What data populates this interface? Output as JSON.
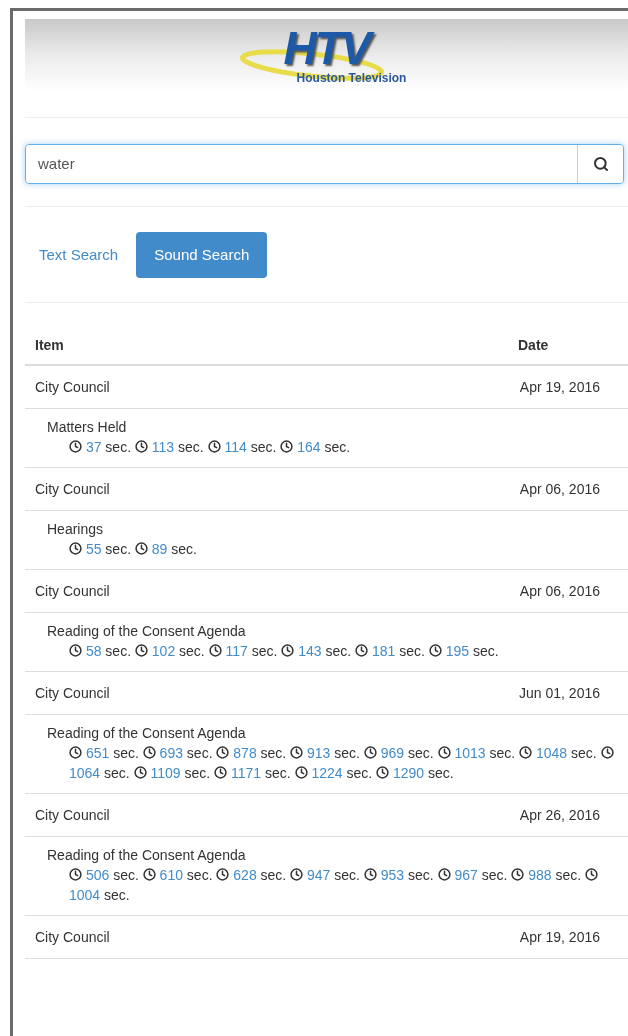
{
  "logo": {
    "mark": "HTV",
    "subtitle": "Houston Television"
  },
  "search": {
    "value": "water"
  },
  "tabs": [
    {
      "label": "Text Search",
      "selected": false
    },
    {
      "label": "Sound Search",
      "selected": true
    }
  ],
  "table": {
    "columns": [
      "Item",
      "Date"
    ],
    "rows": [
      {
        "title": "City Council",
        "date": "Apr 19, 2016",
        "segment": "Matters Held",
        "times": [
          {
            "value": "37",
            "unit": "sec."
          },
          {
            "value": "113",
            "unit": "sec."
          },
          {
            "value": "114",
            "unit": "sec."
          },
          {
            "value": "164",
            "unit": "sec."
          }
        ]
      },
      {
        "title": "City Council",
        "date": "Apr 06, 2016",
        "segment": "Hearings",
        "times": [
          {
            "value": "55",
            "unit": "sec."
          },
          {
            "value": "89",
            "unit": "sec."
          }
        ]
      },
      {
        "title": "City Council",
        "date": "Apr 06, 2016",
        "segment": "Reading of the Consent Agenda",
        "times": [
          {
            "value": "58",
            "unit": "sec."
          },
          {
            "value": "102",
            "unit": "sec."
          },
          {
            "value": "117",
            "unit": "sec."
          },
          {
            "value": "143",
            "unit": "sec."
          },
          {
            "value": "181",
            "unit": "sec."
          },
          {
            "value": "195",
            "unit": "sec."
          }
        ]
      },
      {
        "title": "City Council",
        "date": "Jun 01, 2016",
        "segment": "Reading of the Consent Agenda",
        "times": [
          {
            "value": "651",
            "unit": "sec."
          },
          {
            "value": "693",
            "unit": "sec."
          },
          {
            "value": "878",
            "unit": "sec."
          },
          {
            "value": "913",
            "unit": "sec."
          },
          {
            "value": "969",
            "unit": "sec."
          },
          {
            "value": "1013",
            "unit": "sec."
          },
          {
            "value": "1048",
            "unit": "sec."
          },
          {
            "value": "1064",
            "unit": "sec."
          },
          {
            "value": "1109",
            "unit": "sec."
          },
          {
            "value": "1171",
            "unit": "sec."
          },
          {
            "value": "1224",
            "unit": "sec."
          },
          {
            "value": "1290",
            "unit": "sec."
          }
        ]
      },
      {
        "title": "City Council",
        "date": "Apr 26, 2016",
        "segment": "Reading of the Consent Agenda",
        "times": [
          {
            "value": "506",
            "unit": "sec."
          },
          {
            "value": "610",
            "unit": "sec."
          },
          {
            "value": "628",
            "unit": "sec."
          },
          {
            "value": "947",
            "unit": "sec."
          },
          {
            "value": "953",
            "unit": "sec."
          },
          {
            "value": "967",
            "unit": "sec."
          },
          {
            "value": "988",
            "unit": "sec."
          },
          {
            "value": "1004",
            "unit": "sec."
          }
        ]
      },
      {
        "title": "City Council",
        "date": "Apr 19, 2016"
      }
    ]
  }
}
